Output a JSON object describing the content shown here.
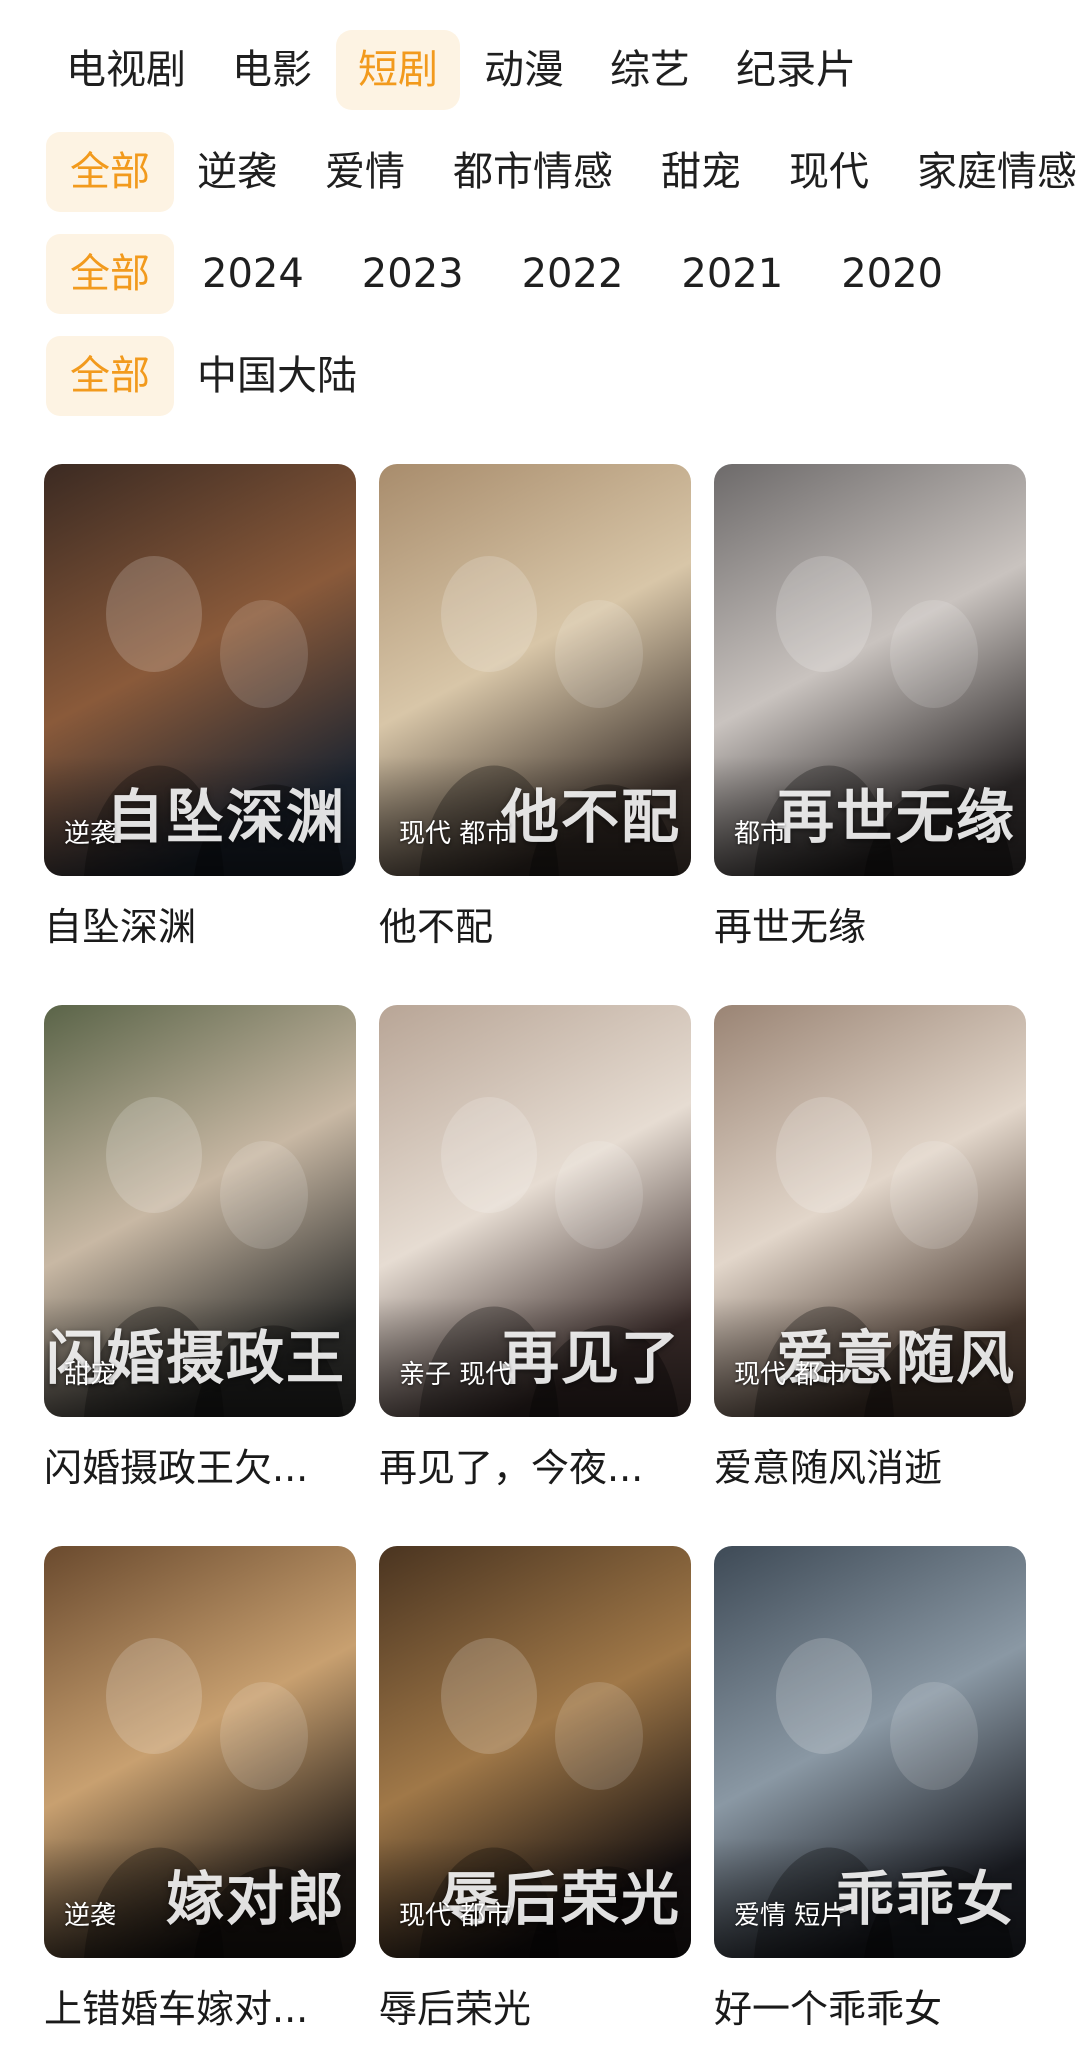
{
  "category_tabs": [
    {
      "label": "电视剧",
      "active": false
    },
    {
      "label": "电影",
      "active": false
    },
    {
      "label": "短剧",
      "active": true
    },
    {
      "label": "动漫",
      "active": false
    },
    {
      "label": "综艺",
      "active": false
    },
    {
      "label": "纪录片",
      "active": false
    }
  ],
  "accent_color": "#f29a1d",
  "active_bg_color": "#fdf3e3",
  "filters": {
    "genre": [
      "全部",
      "逆袭",
      "爱情",
      "都市情感",
      "甜宠",
      "现代",
      "家庭情感"
    ],
    "year": [
      "全部",
      "2024",
      "2023",
      "2022",
      "2021",
      "2020"
    ],
    "region": [
      "全部",
      "中国大陆"
    ]
  },
  "items": [
    {
      "title": "自坠深渊",
      "tags": "逆袭",
      "art_title": "自坠深渊",
      "palette": [
        "#3b2a22",
        "#8a5a3a",
        "#1c2430"
      ]
    },
    {
      "title": "他不配",
      "tags": "现代 都市",
      "art_title": "他不配",
      "palette": [
        "#a88c6c",
        "#d8c6a8",
        "#3a302a"
      ]
    },
    {
      "title": "再世无缘",
      "tags": "都市",
      "art_title": "再世无缘",
      "palette": [
        "#6d6a6a",
        "#c9c3bf",
        "#2a2626"
      ]
    },
    {
      "title": "闪婚摄政王欠...",
      "tags": "甜宠",
      "art_title": "闪婚摄政王",
      "palette": [
        "#5a6448",
        "#c8b8a4",
        "#2c2c2a"
      ]
    },
    {
      "title": "再见了，今夜...",
      "tags": "亲子 现代",
      "art_title": "再见了",
      "palette": [
        "#b8a596",
        "#e6dcd2",
        "#3a2c2a"
      ]
    },
    {
      "title": "爱意随风消逝",
      "tags": "现代 都市",
      "art_title": "爱意随风",
      "palette": [
        "#9a8474",
        "#e2d6ca",
        "#4a3a30"
      ]
    },
    {
      "title": "上错婚车嫁对...",
      "tags": "逆袭",
      "art_title": "嫁对郎",
      "palette": [
        "#6a4a2e",
        "#c8a070",
        "#1e1814"
      ]
    },
    {
      "title": "辱后荣光",
      "tags": "现代 都市",
      "art_title": "辱后荣光",
      "palette": [
        "#4a3420",
        "#a07848",
        "#151010"
      ]
    },
    {
      "title": "好一个乖乖女",
      "tags": "爱情 短片",
      "art_title": "乖乖女",
      "palette": [
        "#3e4a56",
        "#8a98a4",
        "#1a1c22"
      ]
    }
  ]
}
